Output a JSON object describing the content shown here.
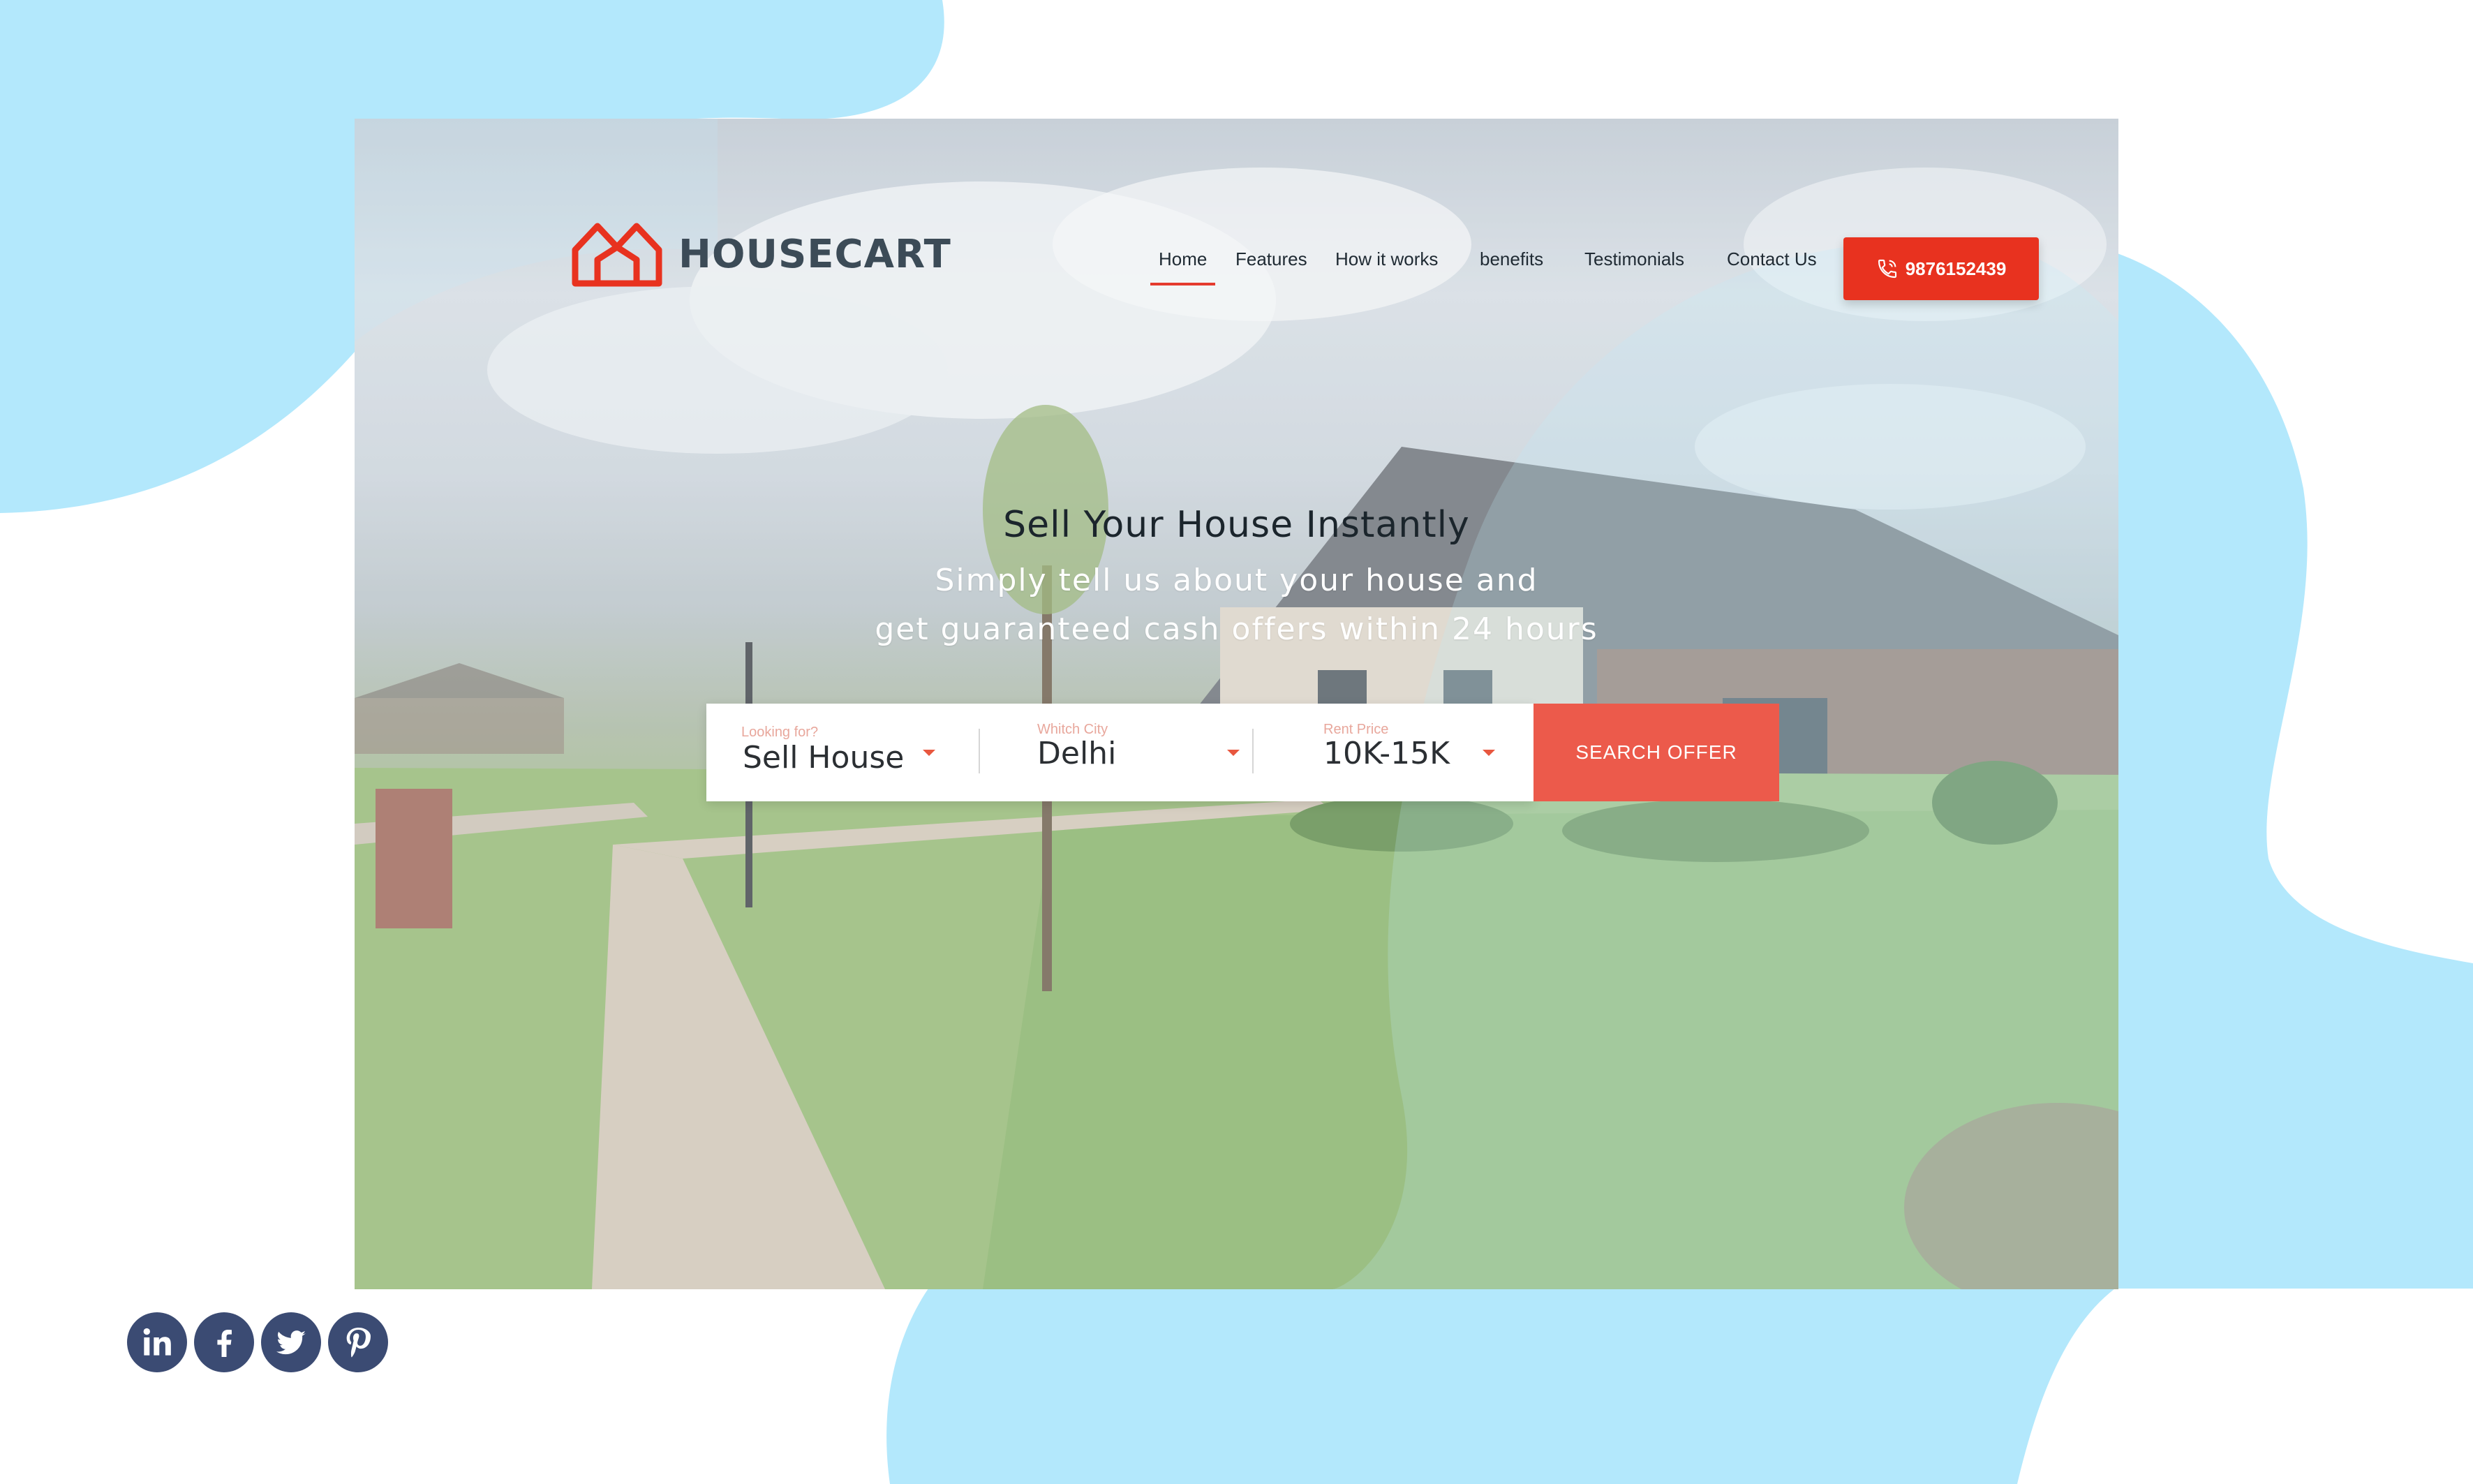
{
  "brand": {
    "name": "HOUSECART",
    "logo_icon": "house-outline-icon",
    "accent_color": "#e8321f"
  },
  "nav": {
    "items": [
      {
        "label": "Home",
        "active": true
      },
      {
        "label": "Features",
        "active": false
      },
      {
        "label": "How it works",
        "active": false
      },
      {
        "label": "benefits",
        "active": false
      },
      {
        "label": "Testimonials",
        "active": false
      },
      {
        "label": "Contact Us",
        "active": false
      }
    ],
    "phone": {
      "label": "9876152439",
      "icon": "phone-icon"
    }
  },
  "hero": {
    "headline": "Sell Your House Instantly",
    "subline_1": "Simply tell us about your house and",
    "subline_2": "get guaranteed cash offers within 24 hours"
  },
  "search": {
    "fields": [
      {
        "label": "Looking for?",
        "value": "Sell House"
      },
      {
        "label": "Whitch City",
        "value": "Delhi"
      },
      {
        "label": "Rent Price",
        "value": "10K-15K"
      }
    ],
    "button_label": "SEARCH OFFER",
    "button_color": "#ec5a4b"
  },
  "social": [
    "linkedin-icon",
    "facebook-icon",
    "twitter-icon",
    "pinterest-icon"
  ],
  "decor": {
    "blob_color": "#b3e8fc",
    "social_color": "#3b4b73"
  }
}
